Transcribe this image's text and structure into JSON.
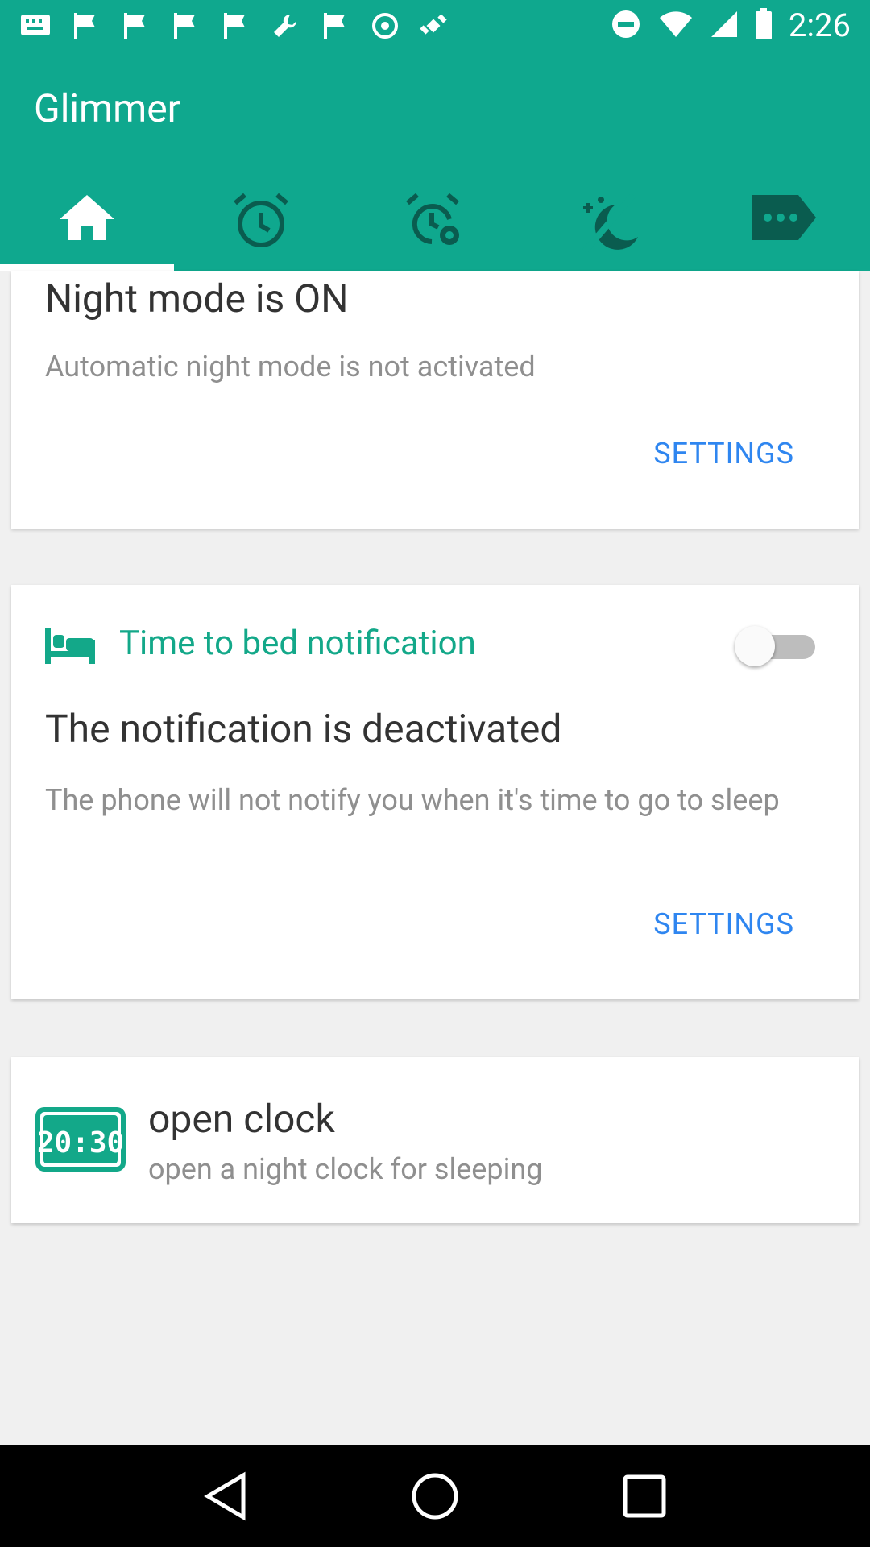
{
  "status_bar": {
    "time": "2:26"
  },
  "app": {
    "title": "Glimmer"
  },
  "tabs": [
    {
      "name": "home-icon",
      "active": true
    },
    {
      "name": "alarm-icon",
      "active": false
    },
    {
      "name": "alarm-settings-icon",
      "active": false
    },
    {
      "name": "night-mode-icon",
      "active": false
    },
    {
      "name": "label-icon",
      "active": false
    }
  ],
  "night_mode_card": {
    "title": "Night mode is ON",
    "subtitle": "Automatic night mode is not activated",
    "settings_label": "SETTINGS"
  },
  "bed_card": {
    "header": "Time to bed notification",
    "toggle_on": false,
    "title": "The notification is deactivated",
    "subtitle": "The phone will not notify you when it's time to go to sleep",
    "settings_label": "SETTINGS"
  },
  "clock_card": {
    "icon_text": "20:30",
    "title": "open clock",
    "subtitle": "open a night clock for sleeping"
  },
  "colors": {
    "primary": "#0fa88e",
    "accent": "#2f86f0",
    "teal_text": "#13a889"
  }
}
